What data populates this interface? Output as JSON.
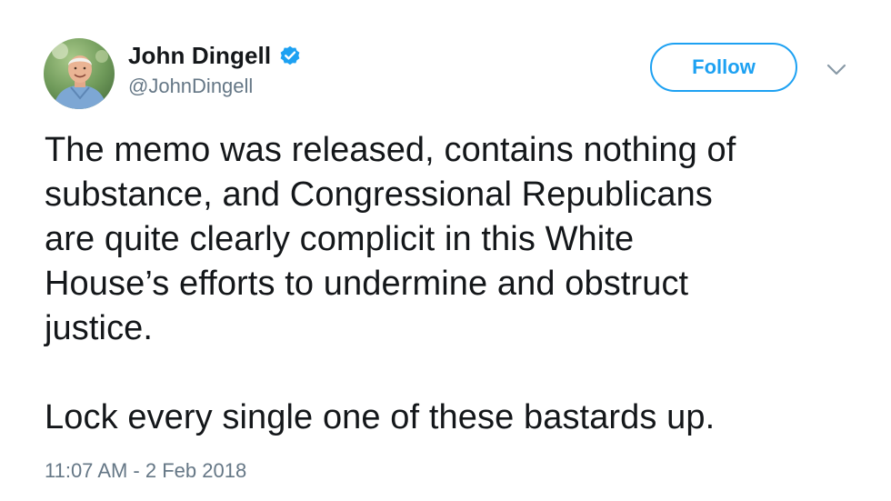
{
  "tweet": {
    "author": {
      "display_name": "John Dingell",
      "handle": "@JohnDingell",
      "verified_icon": "verified-badge-icon",
      "avatar_icon": "profile-photo"
    },
    "follow_label": "Follow",
    "menu_icon": "chevron-down-icon",
    "text_lines": [
      "The memo was released, contains nothing of",
      "substance, and Congressional Republicans",
      "are quite clearly complicit in this White",
      "House’s efforts to undermine and obstruct",
      "justice.",
      "",
      "Lock every single one of these bastards up."
    ],
    "timestamp": "11:07 AM - 2 Feb 2018",
    "colors": {
      "accent": "#1da1f2",
      "text": "#14171a",
      "secondary": "#657786"
    }
  }
}
